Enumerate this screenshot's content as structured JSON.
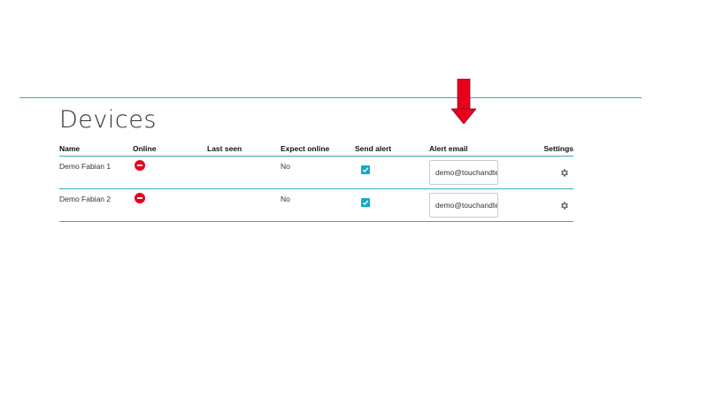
{
  "page": {
    "title": "Devices"
  },
  "table": {
    "columns": [
      "Name",
      "Online",
      "Last seen",
      "Expect online",
      "Send alert",
      "Alert email",
      "Settings"
    ],
    "rows": [
      {
        "name": "Demo Fabian 1",
        "online_status": "offline",
        "last_seen": "",
        "expect_online": "No",
        "send_alert": true,
        "alert_email": "demo@touchandte"
      },
      {
        "name": "Demo Fabian 2",
        "online_status": "offline",
        "last_seen": "",
        "expect_online": "No",
        "send_alert": true,
        "alert_email": "demo@touchandte"
      }
    ]
  },
  "icons": {
    "annotation_arrow": "down-arrow-icon",
    "online": "offline-icon",
    "settings": "gear-icon"
  },
  "colors": {
    "accent": "#3aa8c8",
    "checkbox": "#17a9c9",
    "offline": "#e8001c",
    "arrow": "#e8001c"
  }
}
